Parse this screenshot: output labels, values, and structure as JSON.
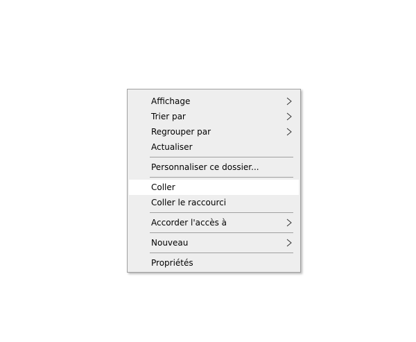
{
  "context_menu": {
    "items": [
      {
        "label": "Affichage",
        "submenu": true
      },
      {
        "label": "Trier par",
        "submenu": true
      },
      {
        "label": "Regrouper par",
        "submenu": true
      },
      {
        "label": "Actualiser",
        "submenu": false
      },
      {
        "label": "Personnaliser ce dossier...",
        "submenu": false
      },
      {
        "label": "Coller",
        "submenu": false,
        "highlighted": true
      },
      {
        "label": "Coller le raccourci",
        "submenu": false
      },
      {
        "label": "Accorder l'accès à",
        "submenu": true
      },
      {
        "label": "Nouveau",
        "submenu": true
      },
      {
        "label": "Propriétés",
        "submenu": false
      }
    ],
    "arrow_icon": "chevron-right-icon",
    "highlight_color": "#ffffff",
    "background_color": "#eeeeee"
  }
}
